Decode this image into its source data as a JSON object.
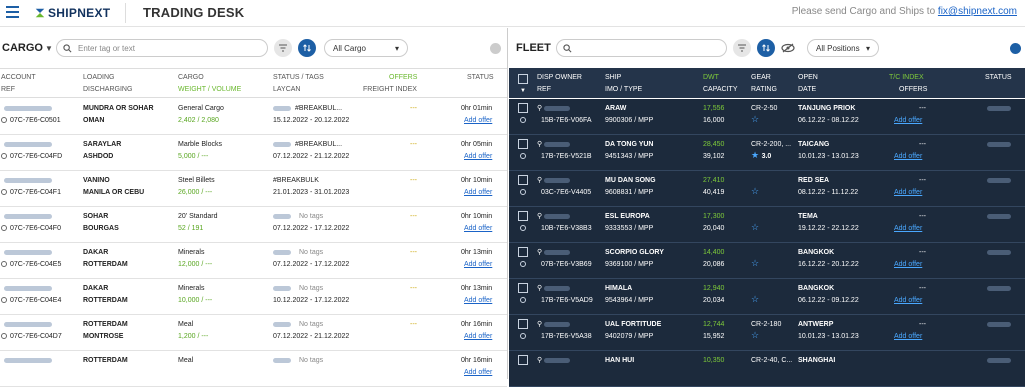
{
  "header": {
    "brand": "SHIPNEXT",
    "title": "TRADING DESK",
    "contact_text": "Please send Cargo and Ships to",
    "contact_email": "fix@shipnext.com"
  },
  "cargo": {
    "title": "CARGO",
    "search_placeholder": "Enter tag or text",
    "filter_label": "All Cargo",
    "columns": {
      "account": "ACCOUNT",
      "ref": "REF",
      "loading": "LOADING",
      "discharging": "DISCHARGING",
      "cargo": "CARGO",
      "weight_volume": "WEIGHT / VOLUME",
      "status_tags": "STATUS / TAGS",
      "laycan": "LAYCAN",
      "offers": "OFFERS",
      "freight_index": "FREIGHT INDEX",
      "status": "STATUS"
    },
    "rows": [
      {
        "ref": "07C-7E6-C0501",
        "loading": "MUNDRA OR SOHAR",
        "discharging": "OMAN",
        "cargo": "General Cargo",
        "weight": "2,402 / 2,080",
        "tag": "#BREAKBUL...",
        "laycan": "15.12.2022 - 20.12.2022",
        "offers": "---",
        "time": "0hr 01min",
        "action": "Add offer"
      },
      {
        "ref": "07C-7E6-C04FD",
        "loading": "SARAYLAR",
        "discharging": "ASHDOD",
        "cargo": "Marble Blocks",
        "weight": "5,000 / ---",
        "tag": "#BREAKBUL...",
        "laycan": "07.12.2022 - 21.12.2022",
        "offers": "---",
        "time": "0hr 05min",
        "action": "Add offer"
      },
      {
        "ref": "07C-7E6-C04F1",
        "loading": "VANINO",
        "discharging": "MANILA OR CEBU",
        "cargo": "Steel Billets",
        "weight": "26,000 / ---",
        "tag": "#BREAKBULK",
        "laycan": "21.01.2023 - 31.01.2023",
        "offers": "---",
        "time": "0hr 10min",
        "action": "Add offer"
      },
      {
        "ref": "07C-7E6-C04F0",
        "loading": "SOHAR",
        "discharging": "BOURGAS",
        "cargo": "20' Standard",
        "weight": "52 / 191",
        "tag": "No tags",
        "laycan": "07.12.2022 - 17.12.2022",
        "offers": "---",
        "time": "0hr 10min",
        "action": "Add offer"
      },
      {
        "ref": "07C-7E6-C04E5",
        "loading": "DAKAR",
        "discharging": "ROTTERDAM",
        "cargo": "Minerals",
        "weight": "12,000 / ---",
        "tag": "No tags",
        "laycan": "07.12.2022 - 17.12.2022",
        "offers": "---",
        "time": "0hr 13min",
        "action": "Add offer"
      },
      {
        "ref": "07C-7E6-C04E4",
        "loading": "DAKAR",
        "discharging": "ROTTERDAM",
        "cargo": "Minerals",
        "weight": "10,000 / ---",
        "tag": "No tags",
        "laycan": "10.12.2022 - 17.12.2022",
        "offers": "---",
        "time": "0hr 13min",
        "action": "Add offer"
      },
      {
        "ref": "07C-7E6-C04D7",
        "loading": "ROTTERDAM",
        "discharging": "MONTROSE",
        "cargo": "Meal",
        "weight": "1,200 / ---",
        "tag": "No tags",
        "laycan": "07.12.2022 - 21.12.2022",
        "offers": "---",
        "time": "0hr 16min",
        "action": "Add offer"
      },
      {
        "ref": "",
        "loading": "ROTTERDAM",
        "discharging": "",
        "cargo": "Meal",
        "weight": "",
        "tag": "No tags",
        "laycan": "",
        "offers": "",
        "time": "0hr 16min",
        "action": "Add offer"
      }
    ]
  },
  "fleet": {
    "title": "FLEET",
    "filter_label": "All Positions",
    "columns": {
      "disp_owner": "DISP OWNER",
      "ref": "REF",
      "ship": "SHIP",
      "imo_type": "IMO / TYPE",
      "dwt": "DWT",
      "capacity": "CAPACITY",
      "gear": "GEAR",
      "rating": "RATING",
      "open": "OPEN",
      "date": "DATE",
      "tc_index": "T/C INDEX",
      "offers": "OFFERS",
      "status": "STATUS"
    },
    "rows": [
      {
        "ref": "15B-7E6-V06FA",
        "ship": "ARAW",
        "imo": "9900306 / MPP",
        "dwt": "17,556",
        "capacity": "16,000",
        "gear": "CR-2-50",
        "rating": "",
        "open": "TANJUNG PRIOK",
        "date": "06.12.22 - 08.12.22",
        "offers": "---",
        "action": "Add offer"
      },
      {
        "ref": "17B-7E6-V521B",
        "ship": "DA TONG YUN",
        "imo": "9451343 / MPP",
        "dwt": "28,450",
        "capacity": "39,102",
        "gear": "CR-2-200, ...",
        "rating": "3.0",
        "open": "TAICANG",
        "date": "10.01.23 - 13.01.23",
        "offers": "---",
        "action": "Add offer"
      },
      {
        "ref": "03C-7E6-V4405",
        "ship": "MU DAN SONG",
        "imo": "9608831 / MPP",
        "dwt": "27,410",
        "capacity": "40,419",
        "gear": "",
        "rating": "",
        "open": "RED SEA",
        "date": "08.12.22 - 11.12.22",
        "offers": "---",
        "action": "Add offer"
      },
      {
        "ref": "10B-7E6-V38B3",
        "ship": "ESL EUROPA",
        "imo": "9333553 / MPP",
        "dwt": "17,300",
        "capacity": "20,040",
        "gear": "",
        "rating": "",
        "open": "TEMA",
        "date": "19.12.22 - 22.12.22",
        "offers": "---",
        "action": "Add offer"
      },
      {
        "ref": "07B-7E6-V3B69",
        "ship": "SCORPIO GLORY",
        "imo": "9369100 / MPP",
        "dwt": "14,400",
        "capacity": "20,086",
        "gear": "",
        "rating": "",
        "open": "BANGKOK",
        "date": "16.12.22 - 20.12.22",
        "offers": "---",
        "action": "Add offer"
      },
      {
        "ref": "17B-7E6-V5AD9",
        "ship": "HIMALA",
        "imo": "9543964 / MPP",
        "dwt": "12,940",
        "capacity": "20,034",
        "gear": "",
        "rating": "",
        "open": "BANGKOK",
        "date": "06.12.22 - 09.12.22",
        "offers": "---",
        "action": "Add offer"
      },
      {
        "ref": "17B-7E6-V5A38",
        "ship": "UAL FORTITUDE",
        "imo": "9402079 / MPP",
        "dwt": "12,744",
        "capacity": "15,952",
        "gear": "CR-2-180",
        "rating": "",
        "open": "ANTWERP",
        "date": "10.01.23 - 13.01.23",
        "offers": "---",
        "action": "Add offer"
      },
      {
        "ref": "",
        "ship": "HAN HUI",
        "imo": "",
        "dwt": "10,350",
        "capacity": "",
        "gear": "CR-2-40, C...",
        "rating": "",
        "open": "SHANGHAI",
        "date": "",
        "offers": "",
        "action": ""
      }
    ]
  }
}
